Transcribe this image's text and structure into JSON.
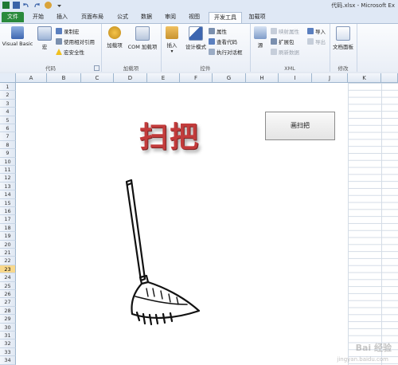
{
  "window": {
    "title": "代码.xlsx - Microsoft Ex"
  },
  "tabs": [
    {
      "label": "文件"
    },
    {
      "label": "开始"
    },
    {
      "label": "插入"
    },
    {
      "label": "页面布局"
    },
    {
      "label": "公式"
    },
    {
      "label": "数据"
    },
    {
      "label": "审阅"
    },
    {
      "label": "视图"
    },
    {
      "label": "开发工具"
    },
    {
      "label": "加载项"
    }
  ],
  "ribbon": {
    "code": {
      "label": "代码",
      "visual_basic": "Visual Basic",
      "macro": "宏",
      "record_macro": "录制宏",
      "relative_ref": "使用相对引用",
      "macro_security": "宏安全性"
    },
    "addins": {
      "label": "加载项",
      "addins": "加载项",
      "com_addins": "COM 加载项"
    },
    "controls": {
      "label": "控件",
      "insert": "插入",
      "design_mode": "设计模式",
      "properties": "属性",
      "view_code": "查看代码",
      "run_dialog": "执行对话框"
    },
    "xml": {
      "label": "XML",
      "source": "源",
      "map_properties": "映射属性",
      "expansion_packs": "扩展包",
      "refresh_data": "刷新数据",
      "import": "导入",
      "export": "导出"
    },
    "modify": {
      "label": "修改",
      "document_panel": "文档面板"
    }
  },
  "columns": [
    "A",
    "B",
    "C",
    "D",
    "E",
    "F",
    "G",
    "H",
    "I",
    "J",
    "K"
  ],
  "rows": [
    "1",
    "2",
    "3",
    "4",
    "5",
    "6",
    "7",
    "8",
    "9",
    "10",
    "11",
    "12",
    "13",
    "14",
    "15",
    "16",
    "17",
    "18",
    "19",
    "20",
    "21",
    "22",
    "23",
    "24",
    "25",
    "26",
    "27",
    "28",
    "29",
    "30",
    "31",
    "32",
    "33",
    "34"
  ],
  "selected_row": "23",
  "sheet": {
    "title_text": "扫把",
    "button_label": "画扫把"
  },
  "watermark": {
    "main": "Bai 经验",
    "sub": "jingyan.baidu.com"
  },
  "colors": {
    "accent_green": "#2a8a3c",
    "title_red": "#c23b3b"
  }
}
